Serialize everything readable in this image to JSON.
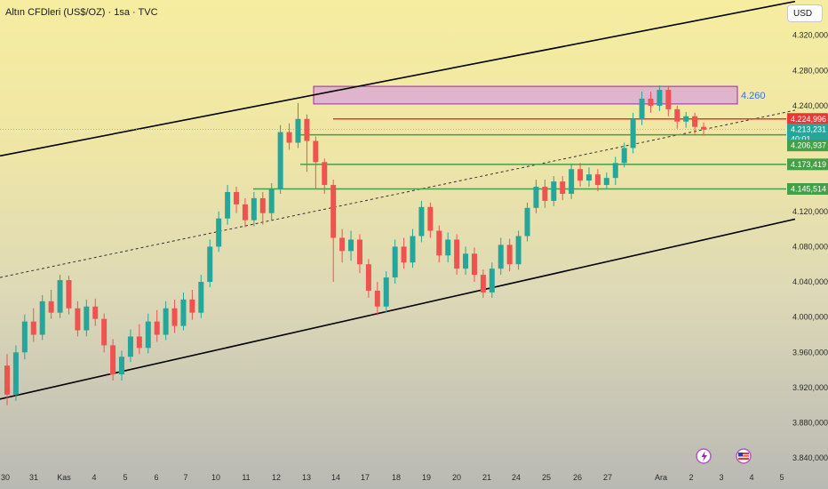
{
  "header": {
    "title": "Altın CFDleri (US$/OZ) · 1sa · TVC",
    "currency": "USD"
  },
  "colors": {
    "up": "#26a69a",
    "down": "#ef5350",
    "support_line": "#43a047",
    "resistance_line": "#e53935",
    "zone_fill": "#d8a3d9",
    "zone_border": "#9c27b0",
    "channel": "#000000"
  },
  "chart_data": {
    "type": "candlestick",
    "ylim": [
      3820,
      4360
    ],
    "y_ticks": [
      {
        "value": 4320,
        "label": "4.320,000"
      },
      {
        "value": 4280,
        "label": "4.280,000"
      },
      {
        "value": 4240,
        "label": "4.240,000"
      },
      {
        "value": 4120,
        "label": "4.120,000"
      },
      {
        "value": 4080,
        "label": "4.080,000"
      },
      {
        "value": 4040,
        "label": "4.040,000"
      },
      {
        "value": 4000,
        "label": "4.000,000"
      },
      {
        "value": 3960,
        "label": "3.960,000"
      },
      {
        "value": 3920,
        "label": "3.920,000"
      },
      {
        "value": 3880,
        "label": "3.880,000"
      },
      {
        "value": 3840,
        "label": "3.840,000"
      }
    ],
    "x_ticks": [
      "30",
      "31",
      "Kas",
      "4",
      "5",
      "6",
      "7",
      "10",
      "11",
      "12",
      "13",
      "14",
      "17",
      "18",
      "19",
      "20",
      "21",
      "24",
      "25",
      "26",
      "27",
      "Ara",
      "2",
      "3",
      "4",
      "5"
    ],
    "price_tags": [
      {
        "value": 4224.996,
        "label": "4.224,996",
        "color": "#e53935"
      },
      {
        "value": 4213.231,
        "label": "4.213,231",
        "color": "#26a69a",
        "countdown": "40:01"
      },
      {
        "value": 4206.937,
        "label": "4.206,937",
        "color": "#43a047"
      },
      {
        "value": 4173.419,
        "label": "4.173,419",
        "color": "#43a047"
      },
      {
        "value": 4145.514,
        "label": "4.145,514",
        "color": "#43a047"
      }
    ],
    "resistance_zone": {
      "low": 4242,
      "high": 4262,
      "label": "4.260"
    },
    "levels": [
      {
        "value": 4224.996,
        "type": "resistance"
      },
      {
        "value": 4206.937,
        "type": "support"
      },
      {
        "value": 4173.419,
        "type": "support"
      },
      {
        "value": 4145.514,
        "type": "support"
      }
    ],
    "channel": {
      "upper": [
        [
          0,
          4183
        ],
        [
          80,
          4341
        ]
      ],
      "lower": [
        [
          0,
          3907
        ],
        [
          80,
          4091
        ]
      ],
      "mid": [
        [
          0,
          4045
        ],
        [
          80,
          4216
        ]
      ]
    },
    "candle_count": 80,
    "candles": [
      [
        3945,
        3912,
        3958,
        3900
      ],
      [
        3912,
        3960,
        3968,
        3905
      ],
      [
        3960,
        3995,
        4003,
        3952
      ],
      [
        3995,
        3980,
        4010,
        3972
      ],
      [
        3980,
        4018,
        4025,
        3974
      ],
      [
        4018,
        4005,
        4031,
        3998
      ],
      [
        4005,
        4042,
        4048,
        3999
      ],
      [
        4042,
        4010,
        4047,
        4003
      ],
      [
        4010,
        3985,
        4018,
        3978
      ],
      [
        3985,
        4012,
        4020,
        3978
      ],
      [
        4012,
        3998,
        4021,
        3990
      ],
      [
        3998,
        3968,
        4004,
        3960
      ],
      [
        3968,
        3935,
        3975,
        3928
      ],
      [
        3935,
        3955,
        3962,
        3928
      ],
      [
        3955,
        3978,
        3986,
        3949
      ],
      [
        3978,
        3965,
        3992,
        3958
      ],
      [
        3965,
        3995,
        4004,
        3959
      ],
      [
        3995,
        3980,
        4008,
        3972
      ],
      [
        3980,
        4010,
        4018,
        3974
      ],
      [
        4010,
        3990,
        4020,
        3982
      ],
      [
        3990,
        4020,
        4028,
        3985
      ],
      [
        4020,
        4005,
        4031,
        3997
      ],
      [
        4005,
        4040,
        4048,
        3999
      ],
      [
        4040,
        4080,
        4088,
        4034
      ],
      [
        4080,
        4112,
        4120,
        4074
      ],
      [
        4112,
        4142,
        4150,
        4105
      ],
      [
        4142,
        4128,
        4148,
        4118
      ],
      [
        4128,
        4110,
        4135,
        4102
      ],
      [
        4110,
        4135,
        4142,
        4103
      ],
      [
        4135,
        4118,
        4142,
        4105
      ],
      [
        4118,
        4145,
        4152,
        4110
      ],
      [
        4145,
        4210,
        4218,
        4140
      ],
      [
        4210,
        4198,
        4220,
        4190
      ],
      [
        4198,
        4225,
        4243,
        4192
      ],
      [
        4225,
        4200,
        4230,
        4165
      ],
      [
        4200,
        4176,
        4205,
        4145
      ],
      [
        4176,
        4150,
        4180,
        4140
      ],
      [
        4150,
        4090,
        4156,
        4040
      ],
      [
        4090,
        4075,
        4100,
        4062
      ],
      [
        4075,
        4088,
        4098,
        4064
      ],
      [
        4088,
        4060,
        4094,
        4050
      ],
      [
        4060,
        4030,
        4066,
        4022
      ],
      [
        4030,
        4012,
        4040,
        4002
      ],
      [
        4012,
        4045,
        4052,
        4005
      ],
      [
        4045,
        4080,
        4088,
        4038
      ],
      [
        4080,
        4062,
        4090,
        4055
      ],
      [
        4062,
        4092,
        4100,
        4056
      ],
      [
        4092,
        4125,
        4132,
        4085
      ],
      [
        4125,
        4098,
        4130,
        4090
      ],
      [
        4098,
        4070,
        4104,
        4062
      ],
      [
        4070,
        4088,
        4096,
        4062
      ],
      [
        4088,
        4055,
        4094,
        4048
      ],
      [
        4055,
        4072,
        4080,
        4048
      ],
      [
        4072,
        4048,
        4079,
        4040
      ],
      [
        4048,
        4028,
        4054,
        4022
      ],
      [
        4028,
        4055,
        4062,
        4022
      ],
      [
        4055,
        4082,
        4090,
        4048
      ],
      [
        4082,
        4060,
        4089,
        4052
      ],
      [
        4060,
        4092,
        4098,
        4054
      ],
      [
        4092,
        4124,
        4130,
        4086
      ],
      [
        4124,
        4148,
        4156,
        4118
      ],
      [
        4148,
        4132,
        4156,
        4124
      ],
      [
        4132,
        4154,
        4160,
        4126
      ],
      [
        4154,
        4140,
        4160,
        4133
      ],
      [
        4140,
        4168,
        4174,
        4134
      ],
      [
        4168,
        4155,
        4175,
        4148
      ],
      [
        4155,
        4162,
        4170,
        4148
      ],
      [
        4162,
        4150,
        4168,
        4143
      ],
      [
        4150,
        4158,
        4164,
        4145
      ],
      [
        4158,
        4175,
        4182,
        4150
      ],
      [
        4175,
        4192,
        4198,
        4170
      ],
      [
        4192,
        4225,
        4232,
        4186
      ],
      [
        4225,
        4248,
        4256,
        4218
      ],
      [
        4248,
        4240,
        4256,
        4232
      ],
      [
        4240,
        4258,
        4263,
        4234
      ],
      [
        4258,
        4236,
        4262,
        4228
      ],
      [
        4236,
        4222,
        4240,
        4214
      ],
      [
        4222,
        4228,
        4233,
        4215
      ],
      [
        4228,
        4216,
        4232,
        4208
      ],
      [
        4216,
        4213,
        4221,
        4206
      ]
    ]
  }
}
